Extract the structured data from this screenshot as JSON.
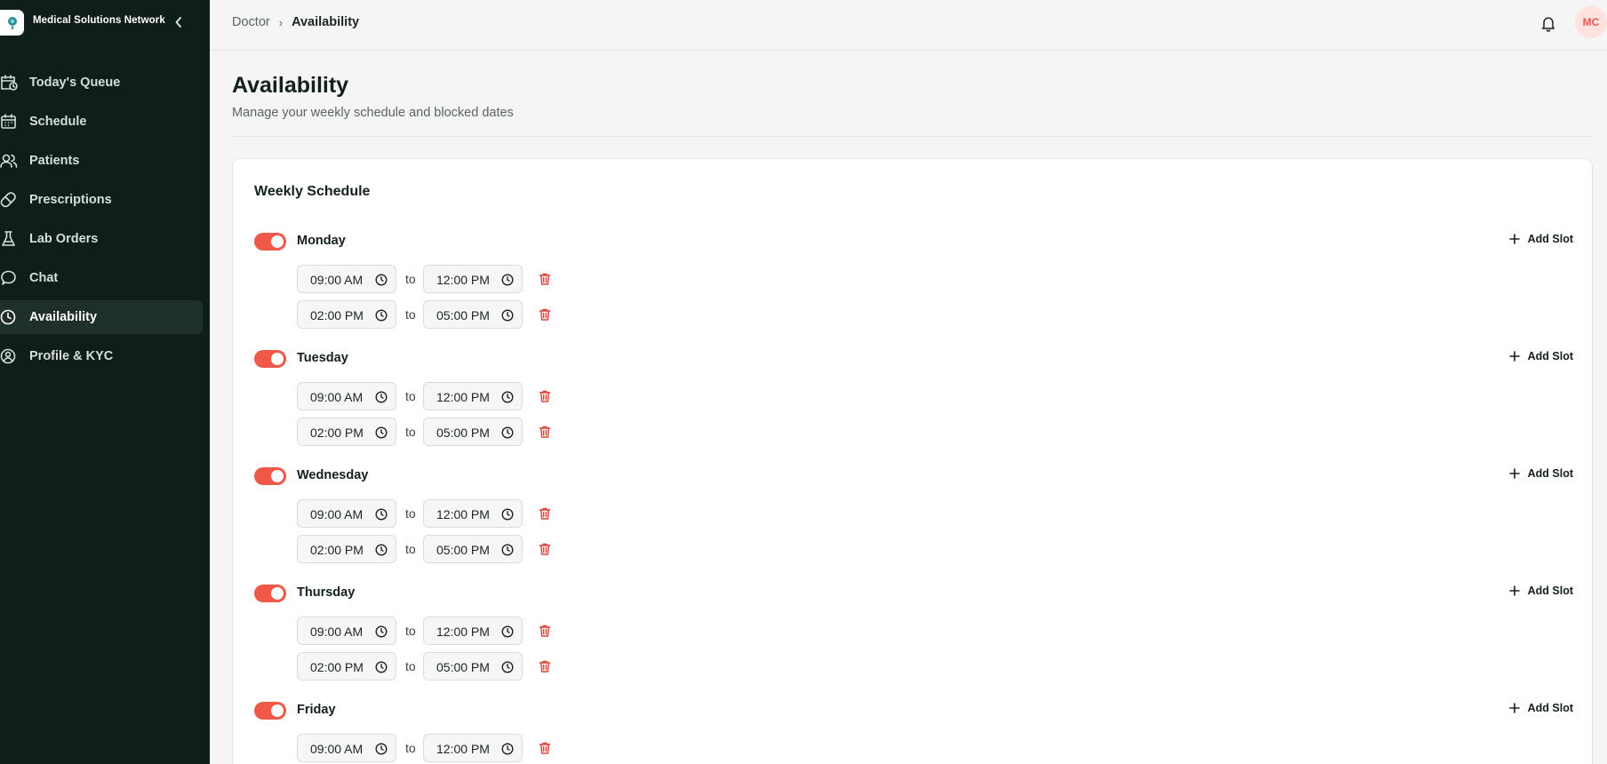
{
  "app": {
    "brand_name": "Medical Solutions Network"
  },
  "sidebar": {
    "items": [
      {
        "label": "Today's Queue",
        "icon": "calendar-clock-icon",
        "active": false
      },
      {
        "label": "Schedule",
        "icon": "calendar-icon",
        "active": false
      },
      {
        "label": "Patients",
        "icon": "users-icon",
        "active": false
      },
      {
        "label": "Prescriptions",
        "icon": "pill-icon",
        "active": false
      },
      {
        "label": "Lab Orders",
        "icon": "flask-icon",
        "active": false
      },
      {
        "label": "Chat",
        "icon": "chat-bubble-icon",
        "active": false
      },
      {
        "label": "Availability",
        "icon": "clock-icon",
        "active": true
      },
      {
        "label": "Profile & KYC",
        "icon": "user-circle-icon",
        "active": false
      }
    ]
  },
  "header": {
    "breadcrumb": {
      "parent": "Doctor",
      "separator": "›",
      "current": "Availability"
    },
    "avatar_initials": "MC"
  },
  "page": {
    "title": "Availability",
    "subtitle": "Manage your weekly schedule and blocked dates"
  },
  "weekly": {
    "title": "Weekly Schedule",
    "add_slot_label": "Add Slot",
    "to_label": "to",
    "days": [
      {
        "name": "Monday",
        "enabled": true,
        "slots": [
          {
            "start": "09:00 AM",
            "end": "12:00 PM"
          },
          {
            "start": "02:00 PM",
            "end": "05:00 PM"
          }
        ]
      },
      {
        "name": "Tuesday",
        "enabled": true,
        "slots": [
          {
            "start": "09:00 AM",
            "end": "12:00 PM"
          },
          {
            "start": "02:00 PM",
            "end": "05:00 PM"
          }
        ]
      },
      {
        "name": "Wednesday",
        "enabled": true,
        "slots": [
          {
            "start": "09:00 AM",
            "end": "12:00 PM"
          },
          {
            "start": "02:00 PM",
            "end": "05:00 PM"
          }
        ]
      },
      {
        "name": "Thursday",
        "enabled": true,
        "slots": [
          {
            "start": "09:00 AM",
            "end": "12:00 PM"
          },
          {
            "start": "02:00 PM",
            "end": "05:00 PM"
          }
        ]
      },
      {
        "name": "Friday",
        "enabled": true,
        "slots": [
          {
            "start": "09:00 AM",
            "end": "12:00 PM"
          }
        ]
      }
    ]
  },
  "colors": {
    "sidebar_bg": "#0f1e1b",
    "accent": "#f0584a",
    "delete": "#e0433a"
  }
}
